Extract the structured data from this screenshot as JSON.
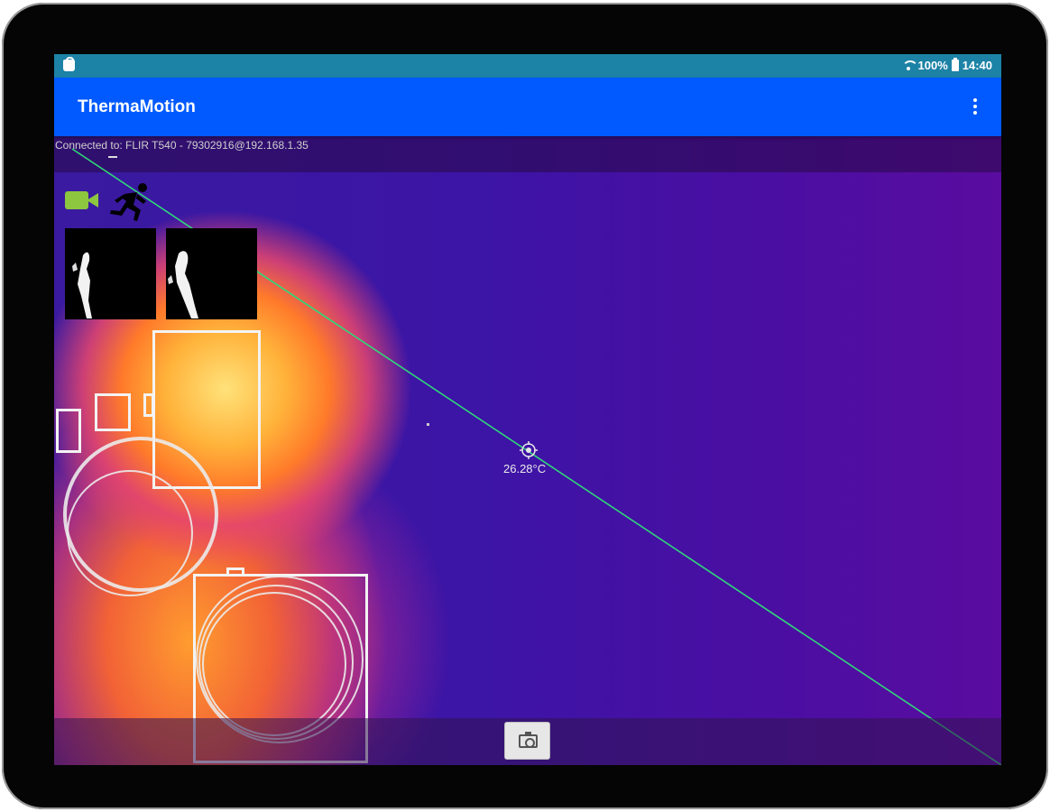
{
  "statusbar": {
    "notification_icon": "shopping-bag-icon",
    "wifi_icon": "wifi-icon",
    "battery": "100%",
    "battery_icon": "battery-icon",
    "time": "14:40"
  },
  "actionbar": {
    "title": "ThermaMotion",
    "menu_icon": "more-vert-icon",
    "color": "#005aff"
  },
  "status_bar_color": "#1c82a6",
  "thermal_view": {
    "connection": "Connected to: FLIR T540 - 79302916@192.168.1.35",
    "recording_icon": "video-camera-icon",
    "motion_icon": "running-person-icon",
    "spot_temperature": "26.28°C",
    "spot_icon": "crosshair-icon",
    "detection_line_color": "#2fd87a",
    "recording_icon_color": "#8dc63f"
  },
  "capture_button_icon": "camera-icon"
}
